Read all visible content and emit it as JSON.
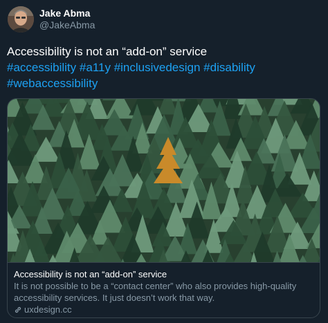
{
  "author": {
    "display_name": "Jake Abma",
    "handle": "@JakeAbma",
    "avatar_icon": "user-avatar"
  },
  "tweet": {
    "text": "Accessibility is not an “add-on” service",
    "hashtags": [
      "#accessibility",
      "#a11y",
      "#inclusivedesign",
      "#disability",
      "#webaccessibility"
    ]
  },
  "card": {
    "image_icon": "pine-forest-photo",
    "title": "Accessibility is not an “add-on” service",
    "description": "It is not possible to be a “contact center” who also provides high-quality accessibility services. It just doesn’t work that way.",
    "domain": "uxdesign.cc",
    "domain_icon": "link-icon"
  },
  "colors": {
    "background": "#15202b",
    "text": "#ffffff",
    "muted": "#8899a6",
    "link": "#1da1f2",
    "border": "#38444d"
  }
}
